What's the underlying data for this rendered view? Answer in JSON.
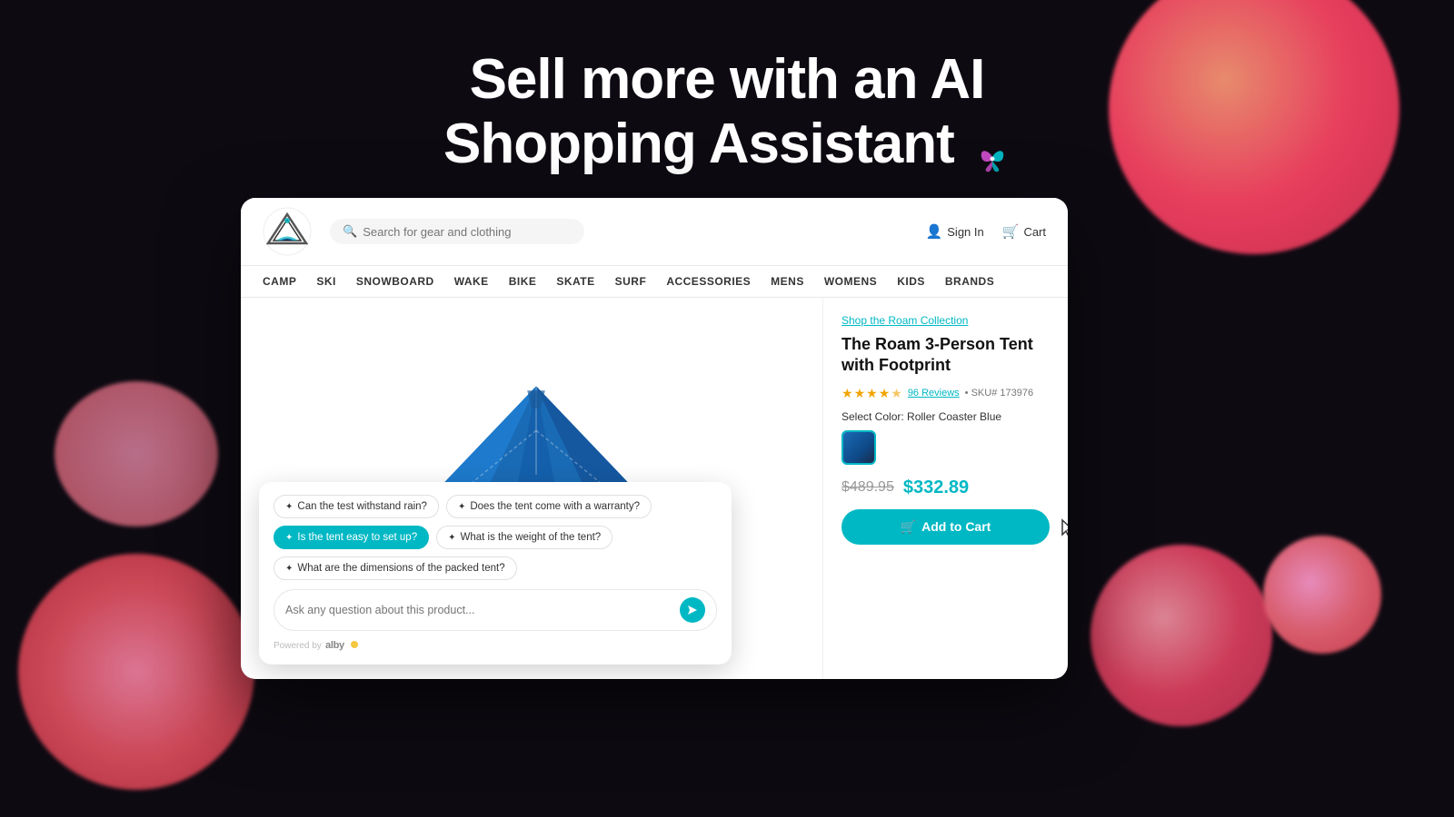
{
  "hero": {
    "line1": "Sell more with an AI",
    "line2": "Shopping Assistant"
  },
  "store": {
    "search_placeholder": "Search for gear and clothing",
    "sign_in_label": "Sign In",
    "cart_label": "Cart",
    "nav_items": [
      "CAMP",
      "SKI",
      "SNOWBOARD",
      "WAKE",
      "BIKE",
      "SKATE",
      "SURF",
      "ACCESSORIES",
      "MENS",
      "WOMENS",
      "KIDS",
      "BRANDS"
    ],
    "collection_link": "Shop the Roam Collection",
    "product_title": "The Roam 3-Person Tent with Footprint",
    "reviews_count": "96 Reviews",
    "sku": "SKU# 173976",
    "color_label": "Select Color: Roller Coaster Blue",
    "price_original": "$489.95",
    "price_sale": "$332.89",
    "add_to_cart": "Add to Cart"
  },
  "chat": {
    "suggestions": [
      {
        "label": "Can the test withstand rain?",
        "active": false
      },
      {
        "label": "Does the tent come with a warranty?",
        "active": false
      },
      {
        "label": "Is the tent easy to set up?",
        "active": true
      },
      {
        "label": "What is the weight of the tent?",
        "active": false
      },
      {
        "label": "What are the dimensions of the packed tent?",
        "active": false
      }
    ],
    "input_placeholder": "Ask any question about this product...",
    "powered_by": "Powered by",
    "alby": "alby"
  }
}
